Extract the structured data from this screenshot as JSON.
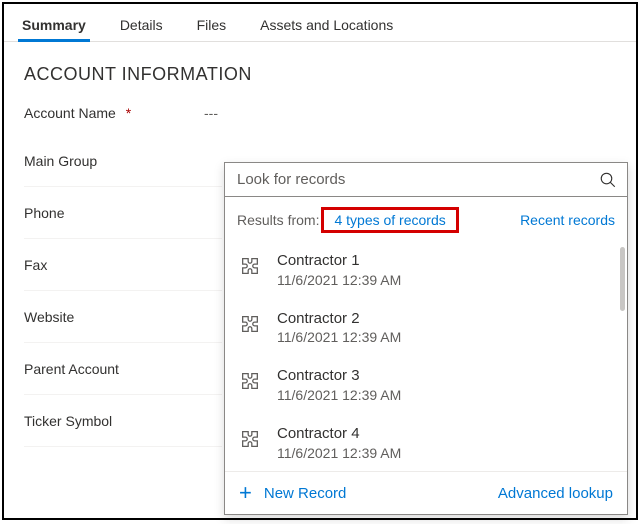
{
  "tabs": [
    "Summary",
    "Details",
    "Files",
    "Assets and Locations"
  ],
  "active_tab": 0,
  "section_title": "ACCOUNT INFORMATION",
  "fields": {
    "account_name": {
      "label": "Account Name",
      "required": true,
      "value": "---"
    },
    "main_group": {
      "label": "Main Group"
    },
    "phone": {
      "label": "Phone"
    },
    "fax": {
      "label": "Fax"
    },
    "website": {
      "label": "Website"
    },
    "parent": {
      "label": "Parent Account"
    },
    "ticker": {
      "label": "Ticker Symbol"
    }
  },
  "lookup": {
    "placeholder": "Look for records",
    "results_from_label": "Results from:",
    "types_link": "4 types of records",
    "recent_label": "Recent records",
    "items": [
      {
        "title": "Contractor 1",
        "sub": "11/6/2021 12:39 AM"
      },
      {
        "title": "Contractor 2",
        "sub": "11/6/2021 12:39 AM"
      },
      {
        "title": "Contractor 3",
        "sub": "11/6/2021 12:39 AM"
      },
      {
        "title": "Contractor 4",
        "sub": "11/6/2021 12:39 AM"
      }
    ],
    "new_record_label": "New Record",
    "advanced_lookup_label": "Advanced lookup"
  }
}
